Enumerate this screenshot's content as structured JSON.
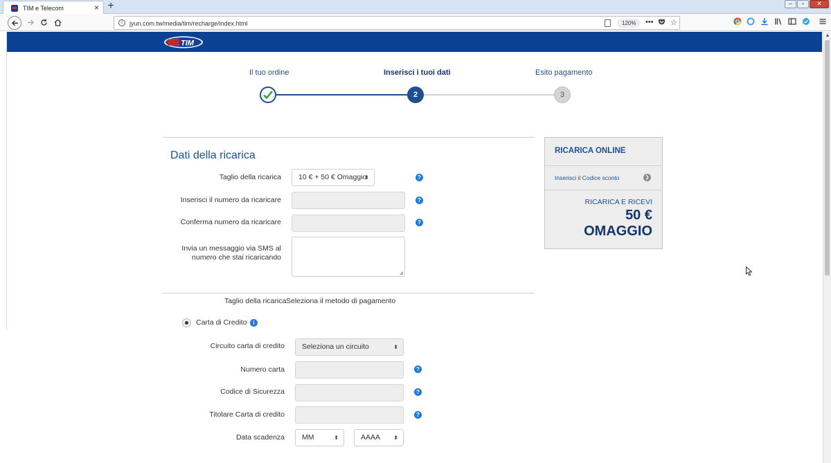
{
  "browser": {
    "tab_title": "TIM e Telecom",
    "tab_close": "×",
    "new_tab": "+",
    "url": "jyun.com.tw/media/tim/recharge/index.html",
    "zoom": "120%",
    "more_actions": "•••",
    "window_minimize": "–",
    "window_maximize": "▫",
    "window_close": "✕"
  },
  "header": {
    "logo_text": "TIM"
  },
  "steps": [
    {
      "label": "Il tuo ordine",
      "state": "done"
    },
    {
      "label": "Inserisci i tuoi dati",
      "number": "2",
      "state": "active"
    },
    {
      "label": "Esito pagamento",
      "number": "3",
      "state": "pending"
    }
  ],
  "recharge_form": {
    "title": "Dati della ricarica",
    "amount_label": "Taglio della ricarica",
    "amount_value": "10 € + 50 € Omaggio",
    "number_label": "Inserisci il numero da ricaricare",
    "number_value": "",
    "confirm_label": "Conferma numero da ricaricare",
    "confirm_value": "",
    "sms_label_line1": "Invia un messaggio via SMS al",
    "sms_label_line2": "numero che stai ricaricando",
    "sms_value": "",
    "help": "?"
  },
  "payment": {
    "amount_summary_label": "Taglio della ricarica",
    "method_label": "Seleziona il metodo di pagamento",
    "credit_card_option": "Carta di Credito",
    "credit_card_selected": true,
    "info": "i",
    "circuit_label": "Circuito carta di credito",
    "circuit_value": "Seleziona un circuito",
    "card_number_label": "Numero carta",
    "security_code_label": "Codice di Sicurezza",
    "holder_label": "Titolare Carta di credito",
    "expiry_label": "Data scadenza",
    "expiry_month": "MM",
    "expiry_year": "AAAA"
  },
  "promo_box": {
    "title": "RICARICA ONLINE",
    "discount_link": "Inserisci il Codice sconto",
    "promo_line1": "RICARICA E RICEVI",
    "promo_line2": "50 €",
    "promo_line3": "OMAGGIO"
  },
  "colors": {
    "brand_blue": "#0b4192",
    "link_blue": "#1d4f91",
    "help_blue": "#1f7ad6",
    "tim_red": "#e32c2c",
    "check_green": "#2e9a3e"
  }
}
